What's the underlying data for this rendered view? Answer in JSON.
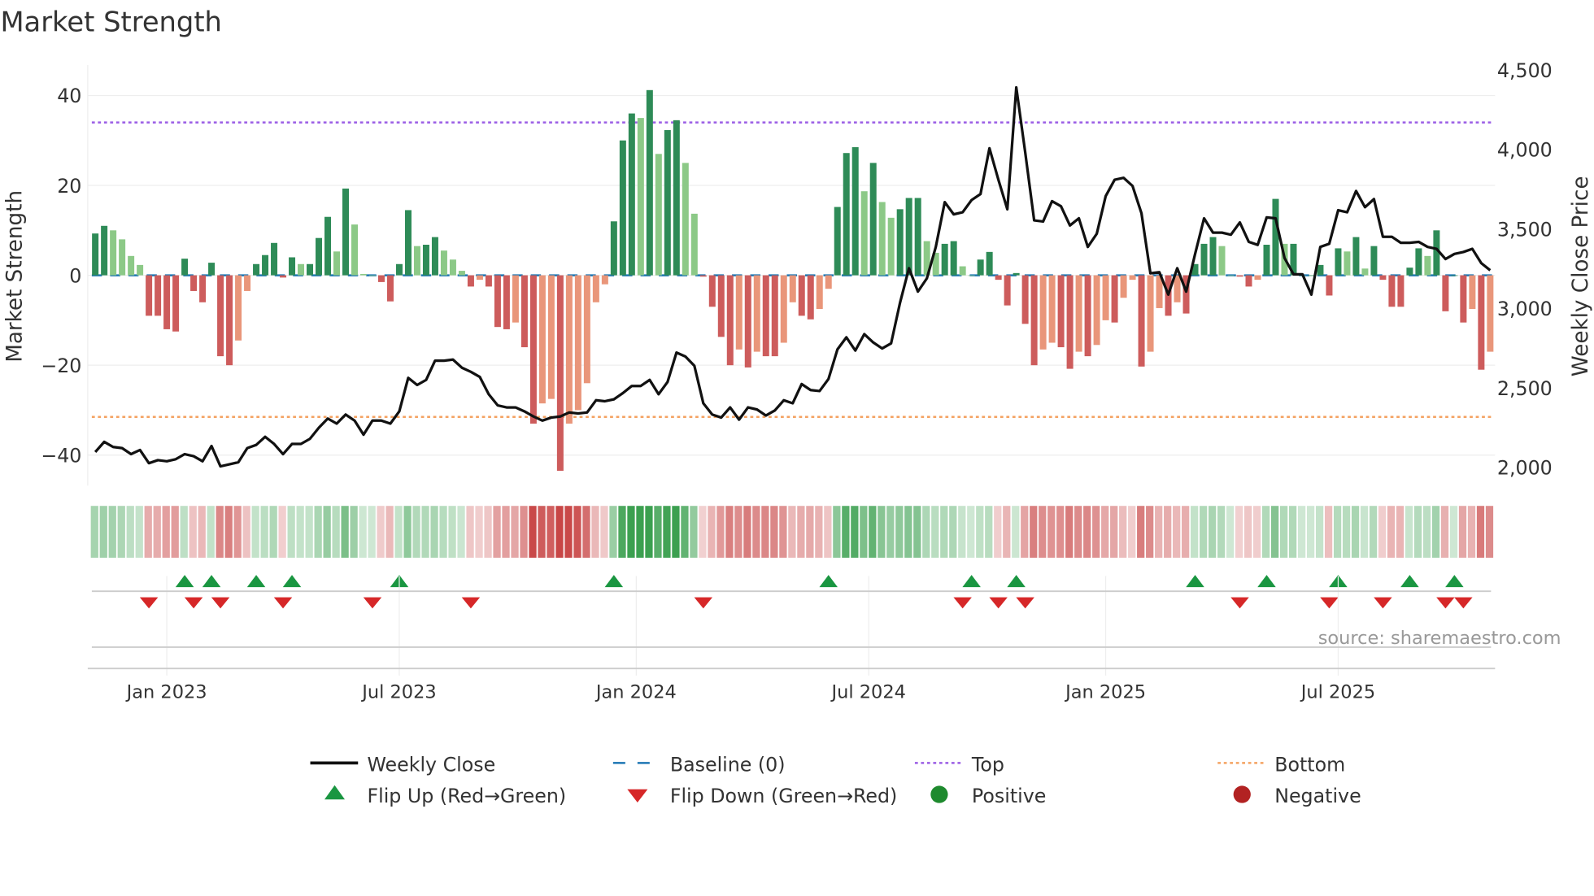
{
  "chart_data": {
    "type": "bar",
    "title": "Market Strength",
    "ylabel": "Market Strength",
    "y2label": "Weekly Close Price",
    "ylim": [
      -47,
      47
    ],
    "y2lim": [
      1880,
      4630
    ],
    "yticks": [
      40,
      20,
      0,
      -20,
      -40
    ],
    "ytick_labels": [
      "40",
      "20",
      "0",
      "−20",
      "−40"
    ],
    "y2ticks": [
      4500,
      4000,
      3500,
      3000,
      2500,
      2000
    ],
    "y2tick_labels": [
      "4,500",
      "4,000",
      "3,500",
      "3,000",
      "2,500",
      "2,000"
    ],
    "xtick_weeks": [
      8,
      34,
      60.5,
      86.5,
      113,
      139
    ],
    "xtick_labels": [
      "Jan 2023",
      "Jul 2023",
      "Jan 2024",
      "Jul 2024",
      "Jan 2025",
      "Jul 2025"
    ],
    "frequency": "weekly",
    "top": 34,
    "bottom": -31.5,
    "baseline": 0,
    "strength": [
      9.3,
      11,
      10,
      8,
      4.3,
      2.3,
      -9,
      -9,
      -12,
      -12.5,
      3.7,
      -3.5,
      -6,
      2.8,
      -18,
      -20,
      -14.5,
      -3.5,
      2.5,
      4.5,
      7.2,
      -0.5,
      4,
      2.5,
      2.5,
      8.3,
      13,
      5.3,
      19.3,
      11.3,
      0.3,
      0,
      -1.5,
      -5.8,
      2.5,
      14.5,
      6.5,
      6.8,
      8.5,
      5.5,
      3.5,
      1,
      -2.5,
      -1,
      -2.5,
      -11.5,
      -12,
      -10.5,
      -16,
      -33,
      -28.5,
      -27.5,
      -43.5,
      -33,
      -30,
      -24,
      -6,
      -2,
      12,
      30,
      36,
      35,
      41.2,
      27,
      32.3,
      34.5,
      25,
      13.7,
      -0.3,
      -7,
      -13.7,
      -20,
      -16.5,
      -20.5,
      -17,
      -18,
      -18,
      -15,
      -6,
      -9,
      -9.8,
      -7.5,
      -3,
      15.2,
      27.2,
      28.5,
      18.7,
      25,
      16.3,
      12.8,
      14.7,
      17.2,
      17.2,
      7.6,
      5,
      7,
      7.6,
      2,
      0,
      3.5,
      5.2,
      -1,
      -6.7,
      0.5,
      -10.8,
      -20,
      -16.5,
      -15,
      -16,
      -20.8,
      -17,
      -18,
      -15.5,
      -10,
      -10.5,
      -5,
      -1,
      -20.3,
      -17,
      -7.3,
      -9,
      -6,
      -8.5,
      2.5,
      7,
      8.5,
      6.5,
      0,
      -0.3,
      -2.5,
      -1,
      6.8,
      17,
      7,
      7,
      0,
      0,
      2.3,
      -4.5,
      6,
      5.3,
      8.5,
      1.5,
      6.5,
      -1,
      -7,
      -7,
      1.7,
      6,
      4.3,
      10,
      -8,
      0,
      -10.5,
      -7.5,
      -21,
      -17
    ],
    "weekly_close": [
      2096,
      2160,
      2128,
      2121,
      2083,
      2109,
      2026,
      2045,
      2038,
      2051,
      2083,
      2070,
      2038,
      2134,
      2006,
      2019,
      2032,
      2121,
      2141,
      2192,
      2147,
      2083,
      2147,
      2147,
      2179,
      2249,
      2307,
      2275,
      2332,
      2294,
      2205,
      2294,
      2294,
      2275,
      2352,
      2563,
      2518,
      2550,
      2671,
      2671,
      2678,
      2627,
      2601,
      2569,
      2460,
      2390,
      2377,
      2377,
      2352,
      2320,
      2294,
      2313,
      2320,
      2345,
      2339,
      2345,
      2422,
      2416,
      2428,
      2467,
      2512,
      2512,
      2550,
      2460,
      2537,
      2722,
      2697,
      2639,
      2403,
      2332,
      2313,
      2377,
      2300,
      2377,
      2364,
      2326,
      2358,
      2422,
      2403,
      2524,
      2486,
      2480,
      2556,
      2742,
      2818,
      2735,
      2838,
      2786,
      2748,
      2780,
      3036,
      3253,
      3106,
      3189,
      3387,
      3669,
      3592,
      3605,
      3682,
      3720,
      4008,
      3810,
      3624,
      4391,
      3982,
      3554,
      3547,
      3675,
      3643,
      3522,
      3567,
      3387,
      3470,
      3707,
      3810,
      3822,
      3771,
      3599,
      3221,
      3228,
      3087,
      3253,
      3106,
      3343,
      3567,
      3477,
      3477,
      3464,
      3541,
      3419,
      3400,
      3573,
      3567,
      3317,
      3215,
      3215,
      3087,
      3387,
      3407,
      3618,
      3605,
      3739,
      3637,
      3688,
      3451,
      3451,
      3413,
      3413,
      3419,
      3387,
      3375,
      3311,
      3343,
      3355,
      3375,
      3285,
      3240
    ],
    "flip_up_weeks": [
      10,
      13,
      18,
      22,
      34,
      58,
      82,
      98,
      103,
      123,
      131,
      139,
      147,
      152
    ],
    "flip_down_weeks": [
      6,
      11,
      14,
      21,
      31,
      42,
      68,
      97,
      101,
      104,
      128,
      138,
      144,
      151,
      153
    ],
    "legend": {
      "placement": "bottom",
      "items": [
        {
          "label": "Weekly Close",
          "kind": "line",
          "color": "#111111"
        },
        {
          "label": "Baseline (0)",
          "kind": "dash",
          "color": "#1f77b4"
        },
        {
          "label": "Top",
          "kind": "dot",
          "color": "#9b5de5"
        },
        {
          "label": "Bottom",
          "kind": "dot",
          "color": "#f4a261"
        },
        {
          "label": "Flip Up (Red→Green)",
          "kind": "up",
          "color": "#1a9641"
        },
        {
          "label": "Flip Down (Green→Red)",
          "kind": "down",
          "color": "#d62728"
        },
        {
          "label": "Positive",
          "kind": "circle",
          "color": "#1e8a2e"
        },
        {
          "label": "Negative",
          "kind": "circle",
          "color": "#b22222"
        }
      ]
    },
    "colors": {
      "pos_strong": "#2e8b57",
      "pos_weak": "#8cc987",
      "neg_strong": "#cd5c5c",
      "neg_weak": "#e9967a",
      "grid": "#eeeeee"
    },
    "source": "source: sharemaestro.com"
  }
}
